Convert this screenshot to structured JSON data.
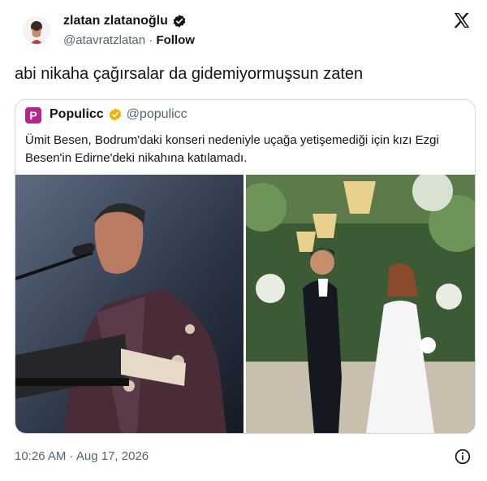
{
  "author": {
    "name": "zlatan zlatanoğlu",
    "handle": "@atavratzlatan",
    "separator": "·",
    "follow_label": "Follow"
  },
  "tweet": {
    "text": "abi nikaha çağırsalar da gidemiyormuşsun zaten"
  },
  "quote": {
    "avatar_letter": "P",
    "name": "Populicc",
    "handle": "@populicc",
    "text": "Ümit Besen, Bodrum'daki konseri nedeniyle uçağa yetişemediği için kızı Ezgi Besen'in Edirne'deki nikahına katılamadı."
  },
  "timestamp": "10:26 AM · Aug 17, 2026",
  "colors": {
    "verified": "#f4b000",
    "brand": "#b7258b",
    "border": "#cfd9de",
    "muted": "#536471"
  },
  "icons": [
    "x-logo-icon",
    "verified-badge-icon",
    "info-icon"
  ]
}
